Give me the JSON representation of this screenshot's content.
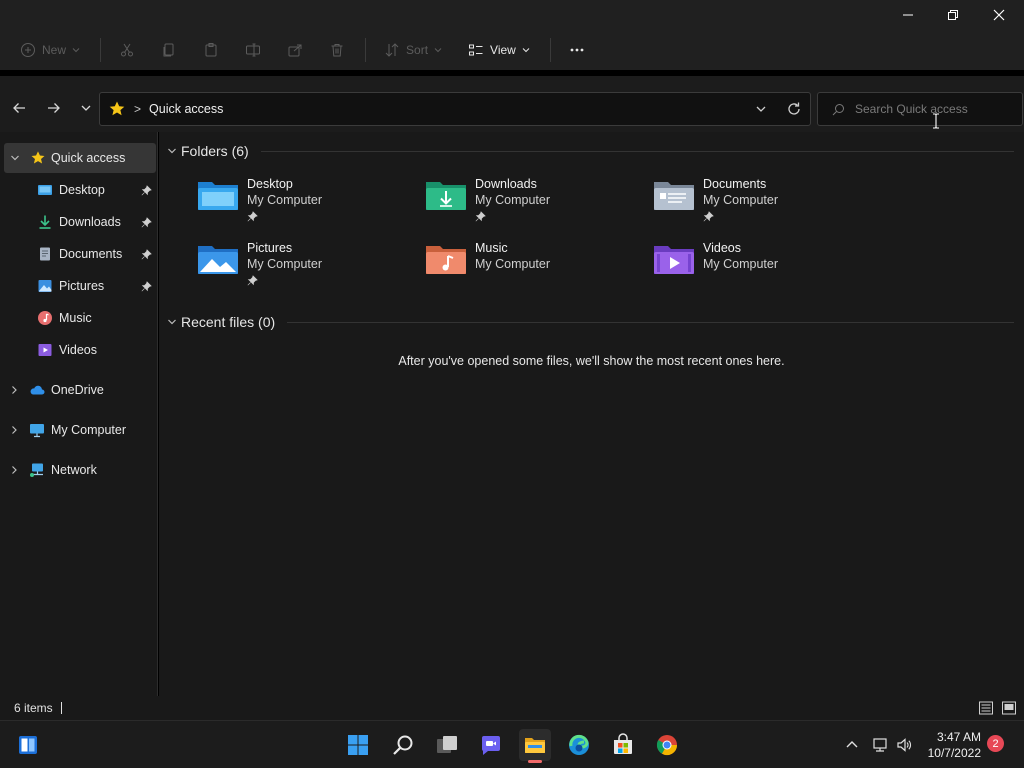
{
  "window": {
    "controls": [
      "minimize",
      "maximize",
      "close"
    ]
  },
  "commandbar": {
    "new_label": "New",
    "sort_label": "Sort",
    "view_label": "View",
    "more_label": "..."
  },
  "navigation": {
    "breadcrumb_separator": ">",
    "location": "Quick access",
    "search_placeholder": "Search Quick access"
  },
  "sidebar": {
    "quick_access": "Quick access",
    "items": [
      {
        "label": "Desktop",
        "icon": "desktop-icon",
        "pinned": true
      },
      {
        "label": "Downloads",
        "icon": "downloads-icon",
        "pinned": true
      },
      {
        "label": "Documents",
        "icon": "documents-icon",
        "pinned": true
      },
      {
        "label": "Pictures",
        "icon": "pictures-icon",
        "pinned": true
      },
      {
        "label": "Music",
        "icon": "music-icon",
        "pinned": false
      },
      {
        "label": "Videos",
        "icon": "videos-icon",
        "pinned": false
      }
    ],
    "roots": [
      {
        "label": "OneDrive",
        "icon": "onedrive-icon"
      },
      {
        "label": "My Computer",
        "icon": "monitor-icon"
      },
      {
        "label": "Network",
        "icon": "network-icon"
      }
    ]
  },
  "main": {
    "folders_header": "Folders (6)",
    "folders": [
      {
        "name": "Desktop",
        "location": "My Computer",
        "pinned": true,
        "icon": "desktop-folder-icon"
      },
      {
        "name": "Downloads",
        "location": "My Computer",
        "pinned": true,
        "icon": "downloads-folder-icon"
      },
      {
        "name": "Documents",
        "location": "My Computer",
        "pinned": true,
        "icon": "documents-folder-icon"
      },
      {
        "name": "Pictures",
        "location": "My Computer",
        "pinned": true,
        "icon": "pictures-folder-icon"
      },
      {
        "name": "Music",
        "location": "My Computer",
        "pinned": false,
        "icon": "music-folder-icon"
      },
      {
        "name": "Videos",
        "location": "My Computer",
        "pinned": false,
        "icon": "videos-folder-icon"
      }
    ],
    "recent_header": "Recent files (0)",
    "recent_empty_message": "After you've opened some files, we'll show the most recent ones here."
  },
  "status": {
    "item_count": "6 items"
  },
  "taskbar": {
    "apps": [
      "widgets-icon",
      "start-icon",
      "search-icon",
      "task-view-icon",
      "teams-chat-icon",
      "file-explorer-icon",
      "edge-icon",
      "store-icon",
      "chrome-icon"
    ],
    "time": "3:47 AM",
    "date": "10/7/2022",
    "notification_count": "2"
  }
}
